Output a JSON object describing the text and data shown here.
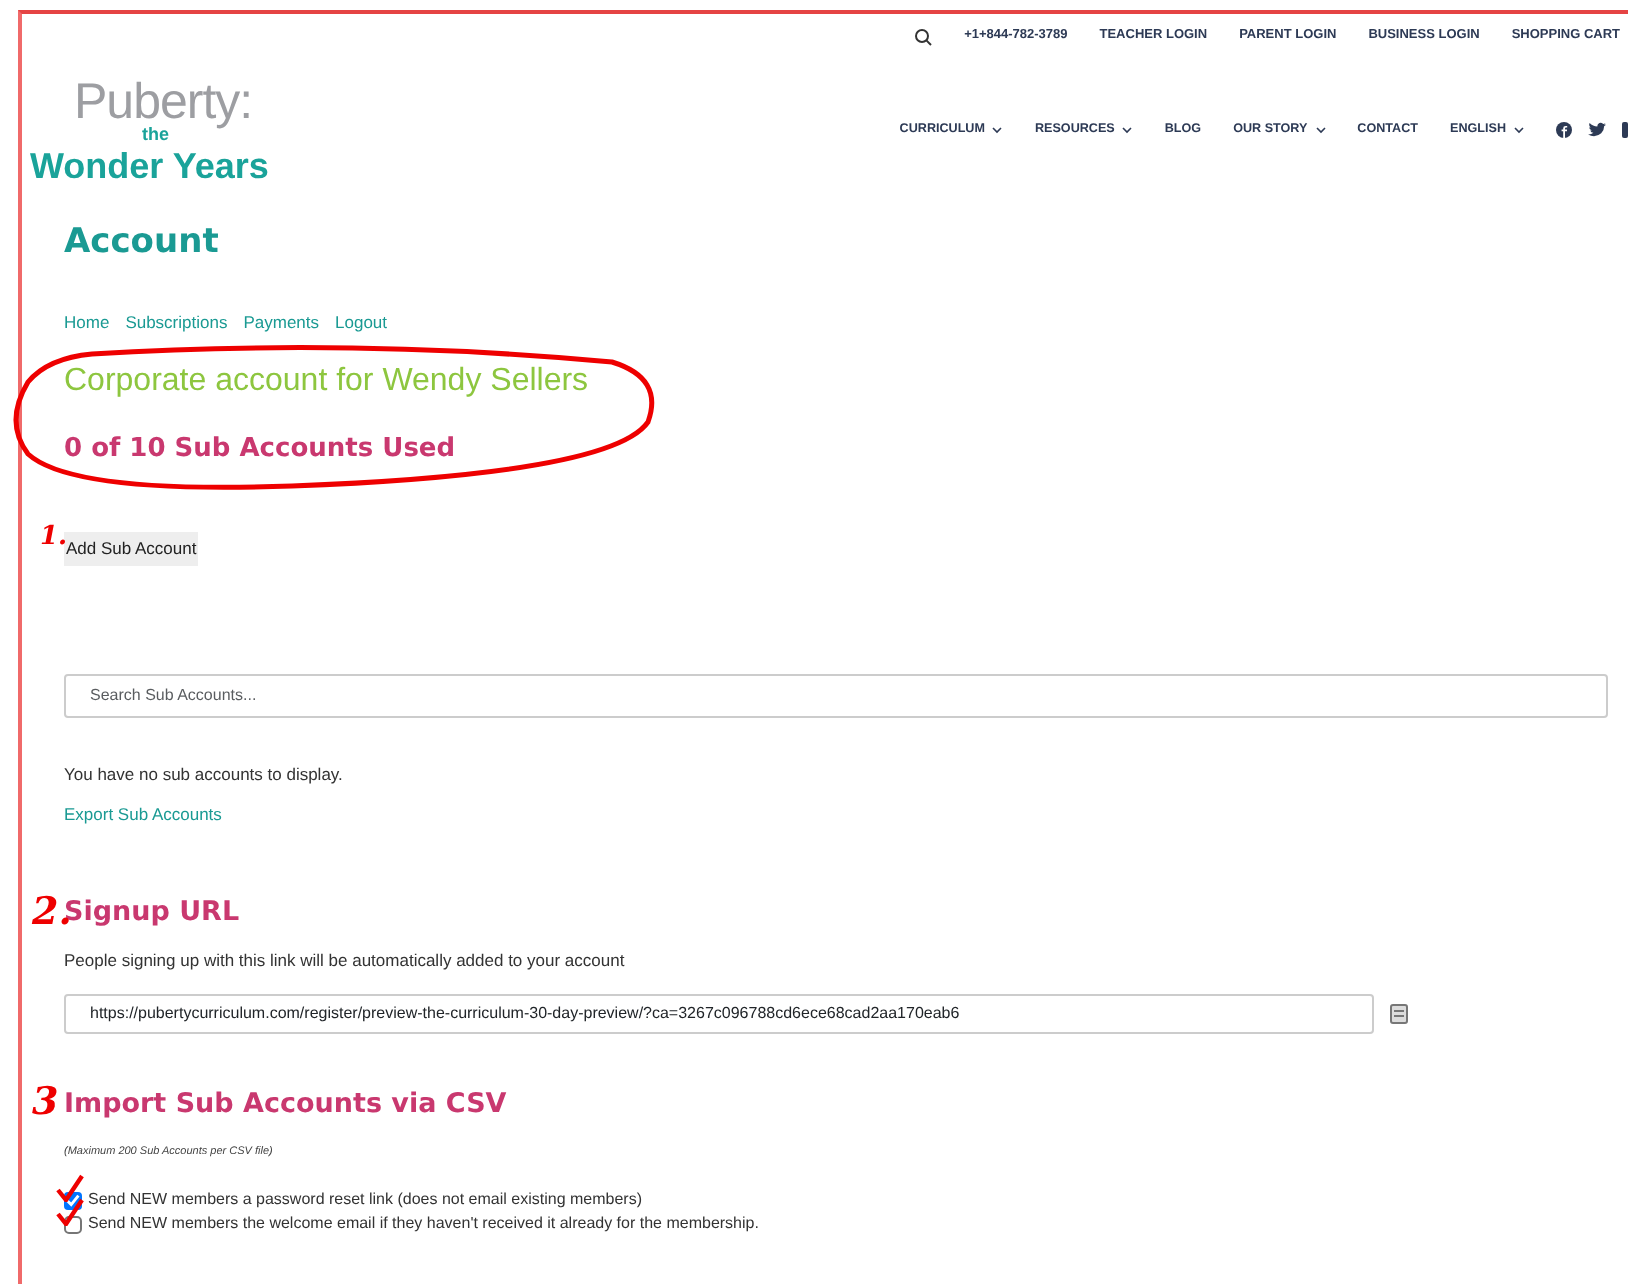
{
  "top_bar": {
    "phone": "+1+844-782-3789",
    "links": [
      "TEACHER LOGIN",
      "PARENT LOGIN",
      "BUSINESS LOGIN",
      "SHOPPING CART"
    ]
  },
  "logo": {
    "top": "Puberty:",
    "middle": "the",
    "bottom": "Wonder Years"
  },
  "nav": [
    {
      "label": "CURRICULUM",
      "dropdown": true
    },
    {
      "label": "RESOURCES",
      "dropdown": true
    },
    {
      "label": "BLOG",
      "dropdown": false
    },
    {
      "label": "OUR STORY",
      "dropdown": true
    },
    {
      "label": "CONTACT",
      "dropdown": false
    },
    {
      "label": "ENGLISH",
      "dropdown": true
    }
  ],
  "page_title": "Account",
  "account_links": [
    "Home",
    "Subscriptions",
    "Payments",
    "Logout"
  ],
  "corporate_title": "Corporate account for Wendy Sellers",
  "usage": "0 of 10 Sub Accounts Used",
  "add_button": "Add Sub Account",
  "search": {
    "placeholder": "Search Sub Accounts..."
  },
  "empty_message": "You have no sub accounts to display.",
  "export_link": "Export Sub Accounts",
  "signup": {
    "heading": "Signup URL",
    "description": "People signing up with this link will be automatically added to your account",
    "url": "https://pubertycurriculum.com/register/preview-the-curriculum-30-day-preview/?ca=3267c096788cd6ece68cad2aa170eab6"
  },
  "import": {
    "heading": "Import Sub Accounts via CSV",
    "note": "(Maximum 200 Sub Accounts per CSV file)",
    "options": [
      {
        "label": "Send NEW members a password reset link (does not email existing members)",
        "checked": true
      },
      {
        "label": "Send NEW members the welcome email if they haven't received it already for the membership.",
        "checked": false
      }
    ]
  },
  "annotations": [
    "1.",
    "2.",
    "3"
  ]
}
